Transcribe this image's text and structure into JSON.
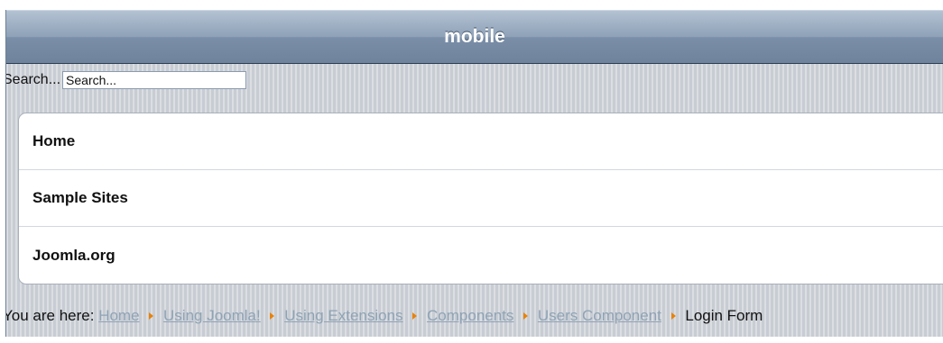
{
  "header": {
    "title": "mobile"
  },
  "search": {
    "label": "Search...",
    "placeholder": "Search..."
  },
  "menu": {
    "items": [
      {
        "label": "Home"
      },
      {
        "label": "Sample Sites"
      },
      {
        "label": "Joomla.org"
      }
    ]
  },
  "breadcrumbs": {
    "prefix": "You are here:",
    "links": [
      {
        "label": "Home"
      },
      {
        "label": "Using Joomla!"
      },
      {
        "label": "Using Extensions"
      },
      {
        "label": "Components"
      },
      {
        "label": "Users Component"
      }
    ],
    "current": "Login Form"
  },
  "colors": {
    "header_gradient_top": "#b4c2d2",
    "header_gradient_bottom": "#6f839c",
    "page_background": "#c8ccd3",
    "breadcrumb_link": "#8fa3b5",
    "breadcrumb_separator": "#e8820a"
  },
  "icons": {
    "breadcrumb_separator": "triangle-right-icon"
  }
}
